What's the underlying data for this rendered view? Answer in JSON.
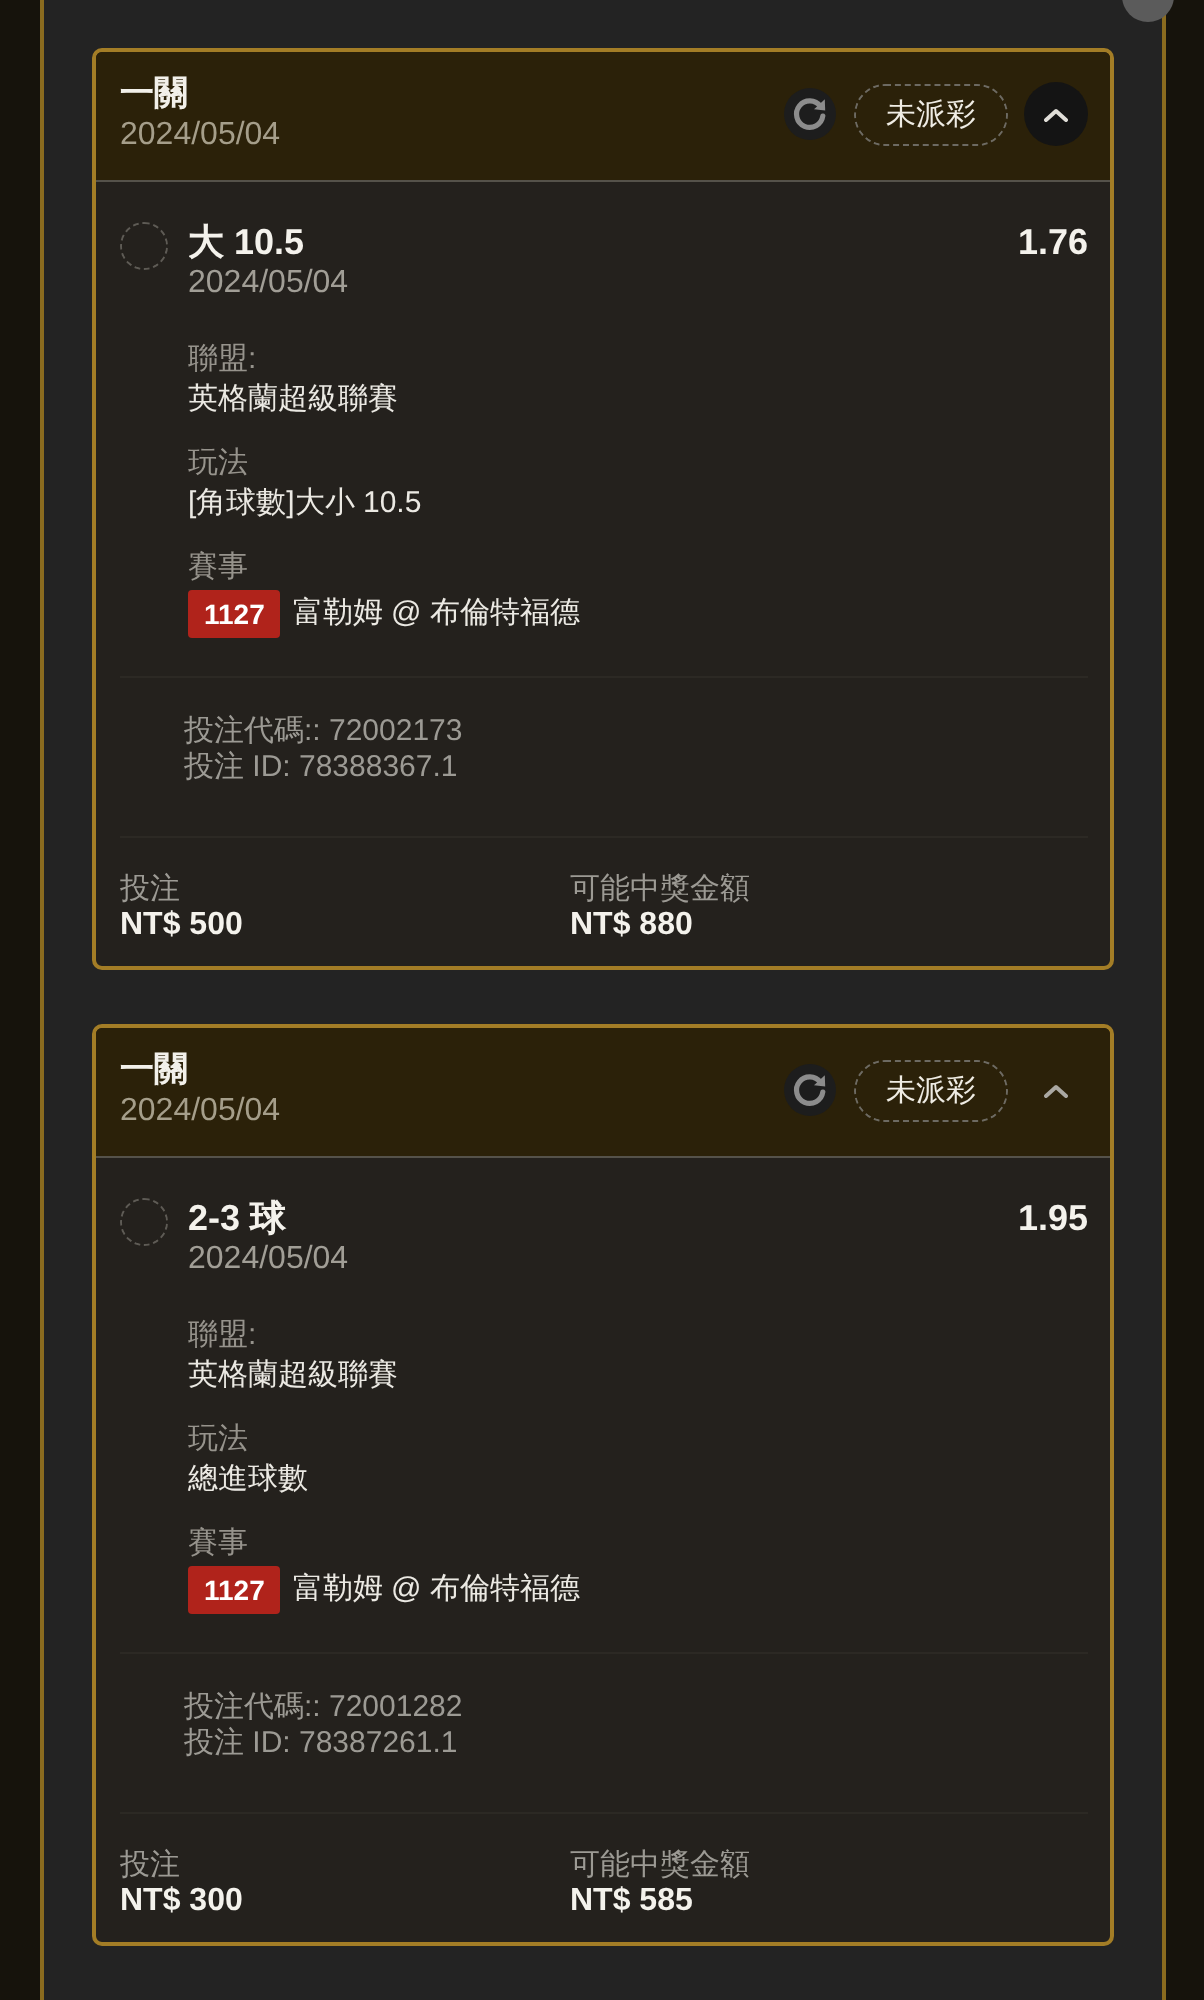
{
  "bets": [
    {
      "title": "一關",
      "date": "2024/05/04",
      "status": "未派彩",
      "expanded": true,
      "toggle_highlighted": true,
      "selection": {
        "name": "大 10.5",
        "date": "2024/05/04",
        "odds": "1.76",
        "selected": false
      },
      "details": [
        {
          "label": "聯盟:",
          "value": "英格蘭超級聯賽"
        },
        {
          "label": "玩法",
          "value": "[角球數]大小 10.5"
        }
      ],
      "event": {
        "label": "賽事",
        "code": "1127",
        "teams": "富勒姆 @ 布倫特福德"
      },
      "bet_code": "投注代碼:: 72002173",
      "bet_id": "投注 ID: 78388367.1",
      "stake": {
        "label": "投注",
        "value": "NT$ 500"
      },
      "payout": {
        "label": "可能中獎金額",
        "value": "NT$ 880"
      }
    },
    {
      "title": "一關",
      "date": "2024/05/04",
      "status": "未派彩",
      "expanded": true,
      "toggle_highlighted": false,
      "selection": {
        "name": "2-3 球",
        "date": "2024/05/04",
        "odds": "1.95",
        "selected": false
      },
      "details": [
        {
          "label": "聯盟:",
          "value": "英格蘭超級聯賽"
        },
        {
          "label": "玩法",
          "value": "總進球數"
        }
      ],
      "event": {
        "label": "賽事",
        "code": "1127",
        "teams": "富勒姆 @ 布倫特福德"
      },
      "bet_code": "投注代碼:: 72001282",
      "bet_id": "投注 ID: 78387261.1",
      "stake": {
        "label": "投注",
        "value": "NT$ 300"
      },
      "payout": {
        "label": "可能中獎金額",
        "value": "NT$ 585"
      }
    }
  ]
}
